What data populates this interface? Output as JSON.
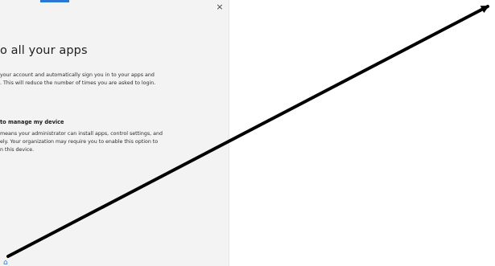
{
  "dialog": {
    "close_icon": "×",
    "heading": "o all your apps",
    "intro_lines": [
      "your account and automatically sign you in to your apps and",
      ". This will reduce the number of times you are asked to login."
    ],
    "option_label": "to manage my device",
    "option_lines": [
      "means your administrator can install apps, control settings, and",
      "ely. Your organization may require you to enable this option to",
      "n this device."
    ],
    "bottom_hint": "⌂"
  },
  "overlay": {
    "arrow_color": "#000000"
  }
}
